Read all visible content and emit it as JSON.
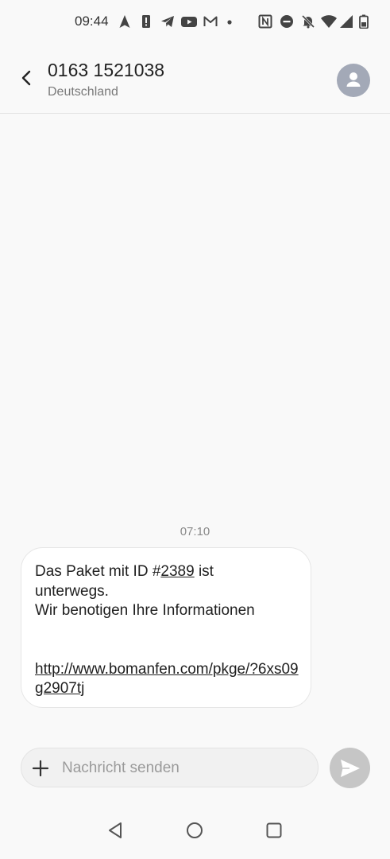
{
  "status_bar": {
    "time": "09:44",
    "left_icons": [
      "navigation-icon",
      "alert-icon",
      "telegram-icon",
      "youtube-icon",
      "gmail-icon",
      "dot-icon"
    ],
    "right_icons": [
      "nfc-icon",
      "do-not-disturb-icon",
      "mute-icon",
      "wifi-icon",
      "signal-icon",
      "battery-icon"
    ]
  },
  "header": {
    "number": "0163 1521038",
    "region": "Deutschland"
  },
  "conversation": {
    "time": "07:10",
    "message": {
      "line1_prefix": "Das Paket mit ID #",
      "line1_id": "2389",
      "line1_suffix": " ist",
      "line2": "unterwegs.",
      "line3": "Wir benotigen Ihre Informationen",
      "link": "http://www.bomanfen.com/pkge/?6xs09g2907tj"
    }
  },
  "compose": {
    "placeholder": "Nachricht senden"
  },
  "colors": {
    "background": "#f9f9f9",
    "bubble": "#ffffff",
    "avatar": "#a3a9b7",
    "send_button": "#c6c6c6"
  }
}
